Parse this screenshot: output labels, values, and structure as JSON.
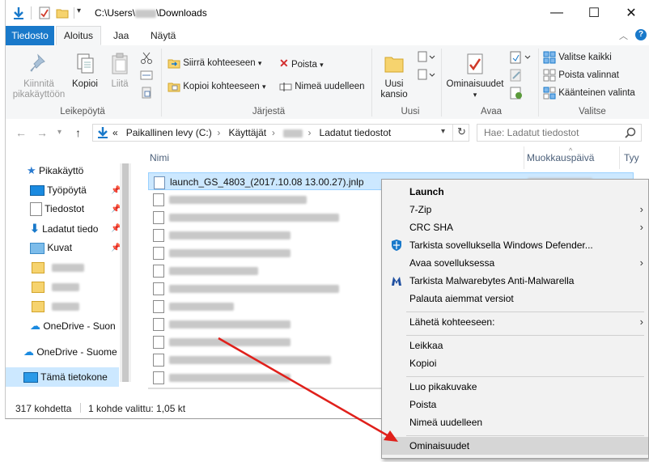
{
  "titlebar": {
    "path_prefix": "C:\\Users\\",
    "path_suffix": "\\Downloads",
    "minimize": "—",
    "maximize": "☐",
    "close": "✕"
  },
  "tabs": {
    "file": "Tiedosto",
    "home": "Aloitus",
    "share": "Jaa",
    "view": "Näytä"
  },
  "ribbon": {
    "clipboard": {
      "pin_label": "Kiinnitä pikakäyttöön",
      "copy_label": "Kopioi",
      "paste_label": "Liitä",
      "group_label": "Leikepöytä"
    },
    "organize": {
      "move_to": "Siirrä kohteeseen",
      "copy_to": "Kopioi kohteeseen",
      "delete": "Poista",
      "rename": "Nimeä uudelleen",
      "group_label": "Järjestä"
    },
    "new": {
      "new_folder": "Uusi kansio",
      "group_label": "Uusi"
    },
    "open": {
      "properties": "Ominaisuudet",
      "group_label": "Avaa"
    },
    "select": {
      "select_all": "Valitse kaikki",
      "select_none": "Poista valinnat",
      "invert": "Käänteinen valinta",
      "group_label": "Valitse"
    }
  },
  "address": {
    "sep": "«",
    "crumb1": "Paikallinen levy (C:)",
    "crumb2": "Käyttäjät",
    "crumb4": "Ladatut tiedostot",
    "search_placeholder": "Hae: Ladatut tiedostot"
  },
  "navpane": {
    "quick_access": "Pikakäyttö",
    "desktop": "Työpöytä",
    "documents": "Tiedostot",
    "downloads": "Ladatut tiedo",
    "pictures": "Kuvat",
    "onedrive1": "OneDrive - Suon",
    "onedrive2": "OneDrive - Suome",
    "this_pc": "Tämä tietokone"
  },
  "filelist": {
    "col_name": "Nimi",
    "col_modified": "Muokkauspäivä",
    "col_type": "Tyy",
    "selected_file": "launch_GS_4803_(2017.10.08 13.00.27).jnlp"
  },
  "status": {
    "count": "317 kohdetta",
    "selected": "1 kohde valittu: 1,05 kt"
  },
  "context_menu": {
    "launch": "Launch",
    "zip": "7-Zip",
    "crc": "CRC SHA",
    "defender": "Tarkista sovelluksella Windows Defender...",
    "open_with": "Avaa sovelluksessa",
    "malwarebytes": "Tarkista Malwarebytes Anti-Malwarella",
    "restore": "Palauta aiemmat versiot",
    "send_to": "Lähetä kohteeseen:",
    "cut": "Leikkaa",
    "copy": "Kopioi",
    "shortcut": "Luo pikakuvake",
    "delete": "Poista",
    "rename": "Nimeä uudelleen",
    "properties": "Ominaisuudet"
  },
  "colors": {
    "accent": "#1979ca",
    "selection": "#cce8ff",
    "arrow": "#e0201b"
  }
}
